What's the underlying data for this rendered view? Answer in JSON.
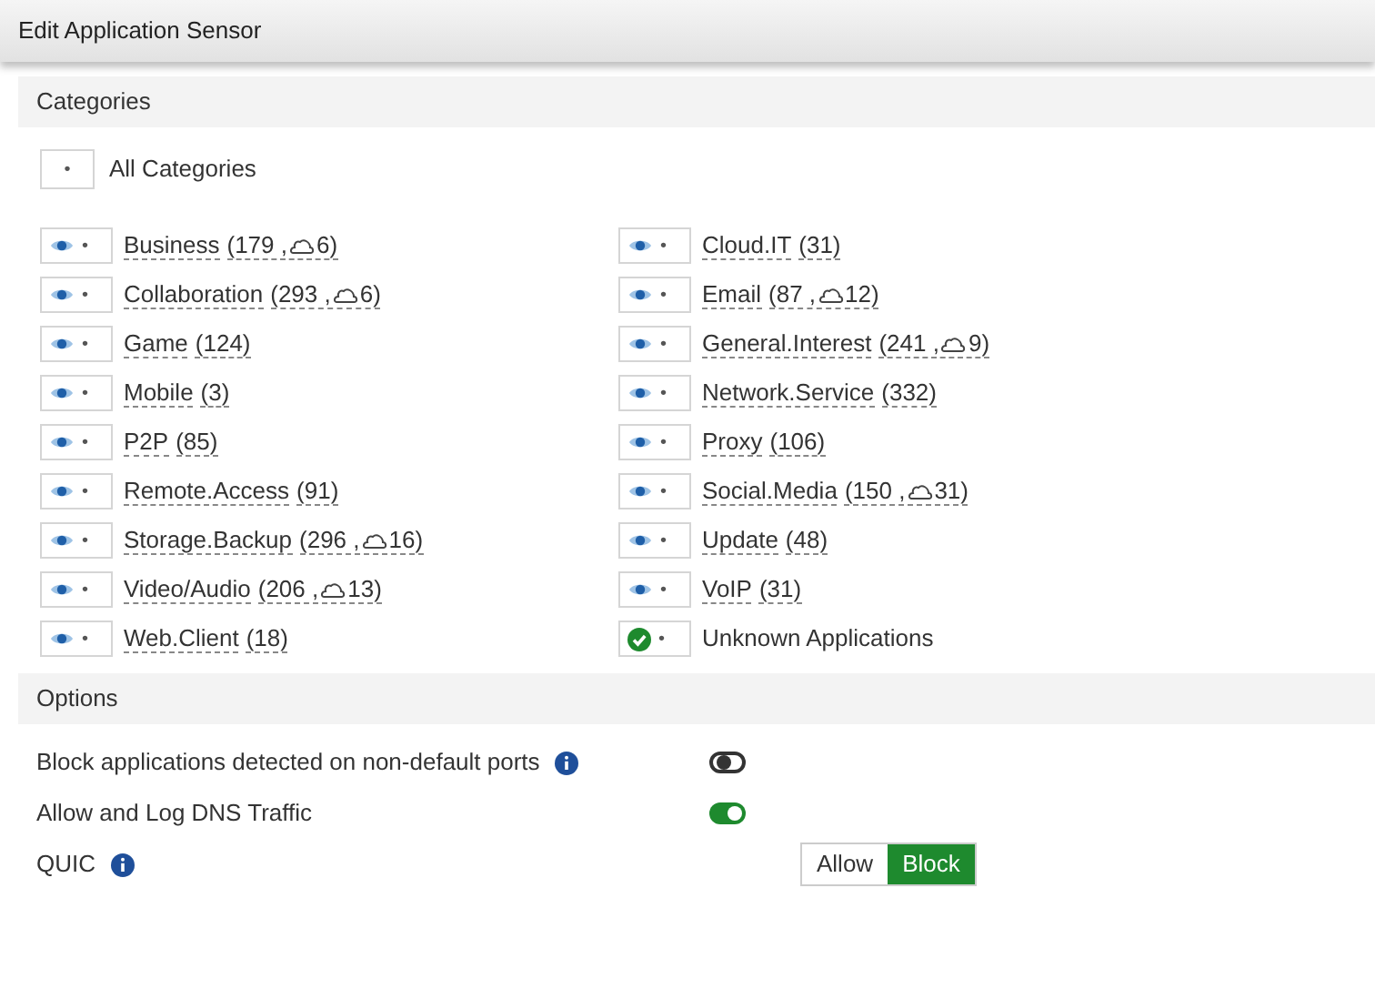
{
  "window": {
    "title": "Edit Application Sensor"
  },
  "categories": {
    "heading": "Categories",
    "all": {
      "marker": "•",
      "label": "All Categories"
    },
    "items": [
      {
        "name": "Business",
        "count": "(179 ,",
        "cloud_count": "6)",
        "kind": "monitor"
      },
      {
        "name": "Cloud.IT",
        "count": "(31)",
        "kind": "monitor"
      },
      {
        "name": "Collaboration",
        "count": "(293 ,",
        "cloud_count": "6)",
        "kind": "monitor"
      },
      {
        "name": "Email",
        "count": "(87 ,",
        "cloud_count": "12)",
        "kind": "monitor"
      },
      {
        "name": "Game",
        "count": "(124)",
        "kind": "monitor"
      },
      {
        "name": "General.Interest",
        "count": "(241 ,",
        "cloud_count": "9)",
        "kind": "monitor"
      },
      {
        "name": "Mobile",
        "count": "(3)",
        "kind": "monitor"
      },
      {
        "name": "Network.Service",
        "count": "(332)",
        "kind": "monitor"
      },
      {
        "name": "P2P",
        "count": "(85)",
        "kind": "monitor"
      },
      {
        "name": "Proxy",
        "count": "(106)",
        "kind": "monitor"
      },
      {
        "name": "Remote.Access",
        "count": "(91)",
        "kind": "monitor"
      },
      {
        "name": "Social.Media",
        "count": "(150 ,",
        "cloud_count": "31)",
        "kind": "monitor"
      },
      {
        "name": "Storage.Backup",
        "count": "(296 ,",
        "cloud_count": "16)",
        "kind": "monitor"
      },
      {
        "name": "Update",
        "count": "(48)",
        "kind": "monitor"
      },
      {
        "name": "Video/Audio",
        "count": "(206 ,",
        "cloud_count": "13)",
        "kind": "monitor"
      },
      {
        "name": "VoIP",
        "count": "(31)",
        "kind": "monitor"
      },
      {
        "name": "Web.Client",
        "count": "(18)",
        "kind": "monitor"
      },
      {
        "name": "Unknown Applications",
        "kind": "allow"
      }
    ],
    "marker": "•"
  },
  "options": {
    "heading": "Options",
    "items": [
      {
        "label": "Block applications detected on non-default ports",
        "info": true,
        "kind": "toggle",
        "on": false
      },
      {
        "label": "Allow and Log DNS Traffic",
        "info": false,
        "kind": "toggle",
        "on": true
      },
      {
        "label": "QUIC",
        "info": true,
        "kind": "segmented",
        "choices": [
          {
            "label": "Allow",
            "selected": false
          },
          {
            "label": "Block",
            "selected": true
          }
        ]
      }
    ]
  }
}
